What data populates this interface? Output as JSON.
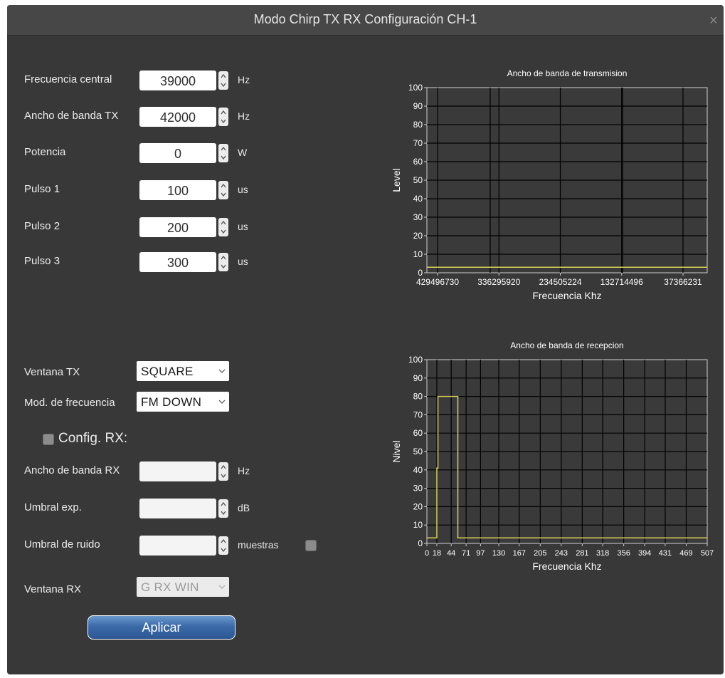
{
  "window": {
    "title": "Modo Chirp TX RX Configuración CH-1",
    "close_glyph": "×"
  },
  "tx_fields": [
    {
      "label": "Frecuencia central",
      "value": "39000",
      "unit": "Hz"
    },
    {
      "label": "Ancho de banda TX",
      "value": "42000",
      "unit": "Hz"
    },
    {
      "label": "Potencia",
      "value": "0",
      "unit": "W"
    },
    {
      "label": "Pulso 1",
      "value": "100",
      "unit": "us"
    },
    {
      "label": "Pulso 2",
      "value": "200",
      "unit": "us"
    },
    {
      "label": "Pulso 3",
      "value": "300",
      "unit": "us"
    }
  ],
  "ventana_tx": {
    "label": "Ventana TX",
    "value": "SQUARE"
  },
  "mod_frecuencia": {
    "label": "Mod. de frecuencia",
    "value": "FM DOWN"
  },
  "config_rx": {
    "label": "Config. RX:",
    "checked": false
  },
  "rx_fields": [
    {
      "label": "Ancho de banda RX",
      "value": "",
      "unit": "Hz"
    },
    {
      "label": "Umbral exp.",
      "value": "",
      "unit": "dB"
    },
    {
      "label": "Umbral de ruido",
      "value": "",
      "unit": "muestras"
    }
  ],
  "ventana_rx": {
    "label": "Ventana RX",
    "value": "G RX WIN"
  },
  "apply_label": "Aplicar",
  "colors": {
    "background": "#383838",
    "plot_line": "#d8d05a",
    "grid": "#000000",
    "button": "#3b6aa8"
  },
  "chart_data": [
    {
      "type": "line",
      "title": "Ancho de banda de transmision",
      "xlabel": "Frecuencia Khz",
      "ylabel": "Level",
      "ylim": [
        0,
        100
      ],
      "yticks": [
        "0",
        "10",
        "20",
        "30",
        "40",
        "50",
        "60",
        "70",
        "80",
        "90",
        "100"
      ],
      "xticks": [
        "429496730",
        "336295920",
        "234505224",
        "132714496",
        "37366231"
      ],
      "grid": true,
      "series": [
        {
          "x": [
            0,
            1
          ],
          "values": [
            3,
            3
          ]
        }
      ]
    },
    {
      "type": "line",
      "title": "Ancho de banda de recepcion",
      "xlabel": "Frecuencia Khz",
      "ylabel": "Nivel",
      "ylim": [
        0,
        100
      ],
      "xlim": [
        0,
        507
      ],
      "yticks": [
        "0",
        "10",
        "20",
        "30",
        "40",
        "50",
        "60",
        "70",
        "80",
        "90",
        "100"
      ],
      "xticks": [
        "0",
        "18",
        "44",
        "71",
        "97",
        "130",
        "167",
        "205",
        "243",
        "281",
        "318",
        "356",
        "394",
        "431",
        "469",
        "507"
      ],
      "grid": true,
      "series": [
        {
          "x": [
            0,
            18,
            18,
            20,
            20,
            56,
            56,
            507
          ],
          "values": [
            3,
            3,
            41,
            41,
            80,
            80,
            3,
            3
          ]
        }
      ]
    }
  ]
}
